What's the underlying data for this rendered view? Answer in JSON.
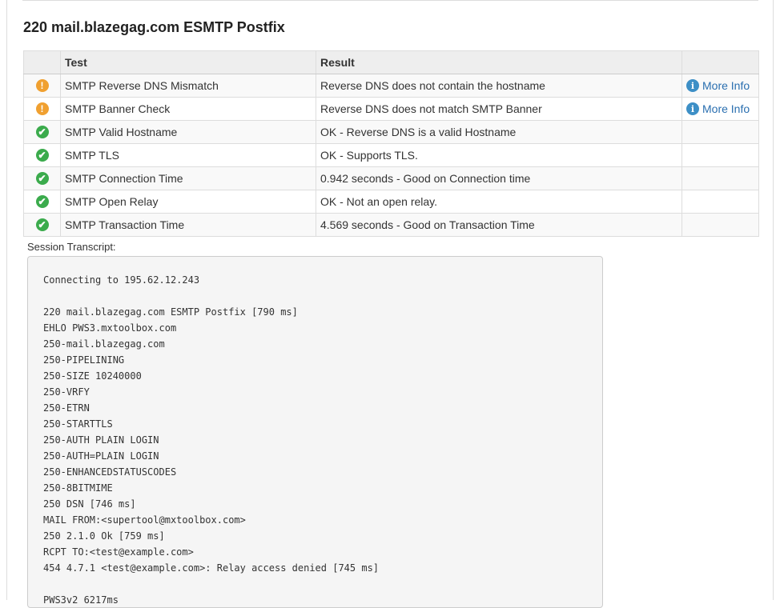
{
  "title": "220 mail.blazegag.com ESMTP Postfix",
  "table": {
    "headers": {
      "icon": "",
      "test": "Test",
      "result": "Result",
      "more": ""
    },
    "rows": [
      {
        "status": "warning",
        "test": "SMTP Reverse DNS Mismatch",
        "result": "Reverse DNS does not contain the hostname",
        "more": "More Info"
      },
      {
        "status": "warning",
        "test": "SMTP Banner Check",
        "result": "Reverse DNS does not match SMTP Banner",
        "more": "More Info"
      },
      {
        "status": "pass",
        "test": "SMTP Valid Hostname",
        "result": "OK - Reverse DNS is a valid Hostname",
        "more": ""
      },
      {
        "status": "pass",
        "test": "SMTP TLS",
        "result": "OK - Supports TLS.",
        "more": ""
      },
      {
        "status": "pass",
        "test": "SMTP Connection Time",
        "result": "0.942 seconds - Good on Connection time",
        "more": ""
      },
      {
        "status": "pass",
        "test": "SMTP Open Relay",
        "result": "OK - Not an open relay.",
        "more": ""
      },
      {
        "status": "pass",
        "test": "SMTP Transaction Time",
        "result": "4.569 seconds - Good on Transaction Time",
        "more": ""
      }
    ]
  },
  "transcript": {
    "label": "Session Transcript:",
    "text": "Connecting to 195.62.12.243\n\n220 mail.blazegag.com ESMTP Postfix [790 ms]\nEHLO PWS3.mxtoolbox.com\n250-mail.blazegag.com\n250-PIPELINING\n250-SIZE 10240000\n250-VRFY\n250-ETRN\n250-STARTTLS\n250-AUTH PLAIN LOGIN\n250-AUTH=PLAIN LOGIN\n250-ENHANCEDSTATUSCODES\n250-8BITMIME\n250 DSN [746 ms]\nMAIL FROM:<supertool@mxtoolbox.com>\n250 2.1.0 Ok [759 ms]\nRCPT TO:<test@example.com>\n454 4.7.1 <test@example.com>: Relay access denied [745 ms]\n\nPWS3v2 6217ms"
  },
  "colors": {
    "warning": "#f0a030",
    "pass": "#3bab4c",
    "info": "#3d8fc6",
    "link": "#2a6fb0"
  },
  "icons": {
    "warning": "exclamation-circle-icon",
    "pass": "check-circle-icon",
    "info": "info-circle-icon"
  }
}
